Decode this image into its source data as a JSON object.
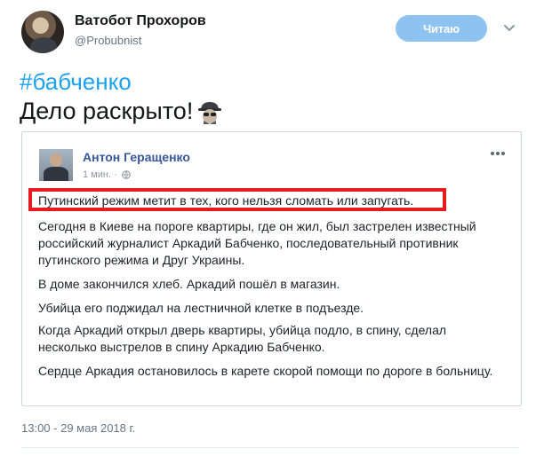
{
  "tweet": {
    "author_name": "Ватобот Прохоров",
    "author_handle": "@Probubnist",
    "follow_label": "Читаю",
    "hashtag": "#бабченко",
    "text": "Дело раскрыто!",
    "timestamp": "13:00 - 29 мая 2018 г."
  },
  "embedded_post": {
    "author": "Антон Геращенко",
    "time": "1 мин.",
    "paragraphs": [
      "Путинский режим метит в тех, кого нельзя сломать или запугать.",
      "Сегодня в Киеве на пороге квартиры, где он жил, был застрелен известный российский журналист Аркадий Бабченко, последовательный противник путинского режима и Друг Украины.",
      "В доме закончился хлеб. Аркадий пошёл в магазин.",
      "Убийца его поджидал на лестничной клетке в подъезде.",
      "Когда Аркадий открыл дверь квартиры, убийца подло, в спину, сделал несколько выстрелов в спину Аркадию Бабченко.",
      "Сердце Аркадия остановилось в карете скорой помощи по дороге в больницу."
    ]
  },
  "icons": {
    "chevron": "chevron-down-icon",
    "spy": "spy-emoji-icon",
    "globe": "globe-icon",
    "more": "more-options-icon"
  },
  "colors": {
    "hashtag": "#1da1f2",
    "follow_button": "#8ec3f1",
    "highlight_border": "#e8191f",
    "fb_author": "#365899"
  }
}
